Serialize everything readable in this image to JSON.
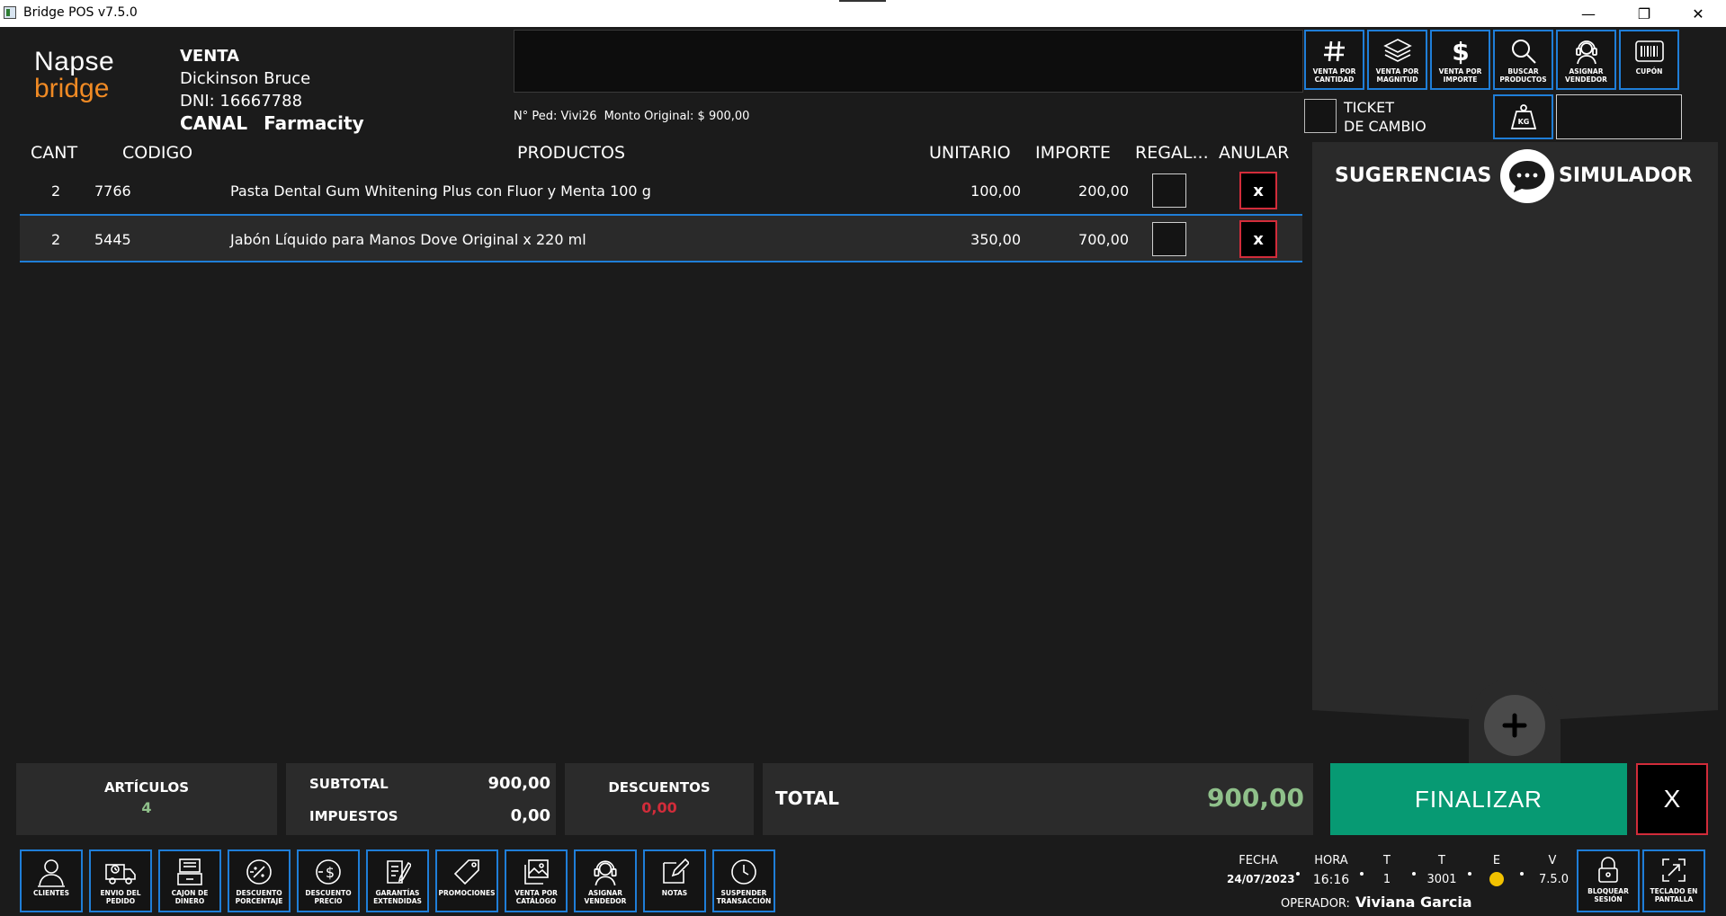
{
  "window": {
    "title": "Bridge POS v7.5.0",
    "controls": {
      "minimize": "—",
      "restore": "❐",
      "close": "✕"
    }
  },
  "logo": {
    "line1": "Napse",
    "line2": "bridge"
  },
  "customer": {
    "mode": "VENTA",
    "name": "Dickinson Bruce",
    "dni": "DNI: 16667788",
    "canal_label": "CANAL",
    "canal_value": "Farmacity"
  },
  "order": {
    "pedido": "N° Ped: Vivi26",
    "monto": "Monto Original: $ 900,00"
  },
  "top_actions": [
    {
      "icon": "hash-icon",
      "label": "VENTA POR CANTIDAD"
    },
    {
      "icon": "layers-icon",
      "label": "VENTA POR MAGNITUD"
    },
    {
      "icon": "dollar-icon",
      "label": "VENTA POR IMPORTE"
    },
    {
      "icon": "search-icon",
      "label": "BUSCAR PRODUCTOS"
    },
    {
      "icon": "headset-icon",
      "label": "ASIGNAR VENDEDOR"
    },
    {
      "icon": "barcode-icon",
      "label": "CUPÓN"
    }
  ],
  "ticket_cambio": {
    "line1": "TICKET",
    "line2": "DE CAMBIO"
  },
  "kg_label": "KG",
  "table": {
    "headers": {
      "cant": "CANT",
      "codigo": "CODIGO",
      "productos": "PRODUCTOS",
      "unitario": "UNITARIO",
      "importe": "IMPORTE",
      "regalo": "REGAL...",
      "anular": "ANULAR"
    },
    "rows": [
      {
        "cant": "2",
        "codigo": "7766",
        "producto": "Pasta Dental Gum Whitening Plus con Fluor y Menta 100 g",
        "unitario": "100,00",
        "importe": "200,00",
        "anular": "x"
      },
      {
        "cant": "2",
        "codigo": "5445",
        "producto": "Jabón Líquido para Manos Dove Original x 220 ml",
        "unitario": "350,00",
        "importe": "700,00",
        "anular": "x"
      }
    ]
  },
  "suggestions": {
    "left": "SUGERENCIAS",
    "right": "SIMULADOR"
  },
  "summary": {
    "articulos_label": "ARTÍCULOS",
    "articulos_value": "4",
    "subtotal_label": "SUBTOTAL",
    "subtotal_value": "900,00",
    "impuestos_label": "IMPUESTOS",
    "impuestos_value": "0,00",
    "descuentos_label": "DESCUENTOS",
    "descuentos_value": "0,00",
    "total_label": "TOTAL",
    "total_value": "900,00",
    "finalizar": "FINALIZAR",
    "cancel": "X"
  },
  "bottom_actions": [
    {
      "icon": "user-icon",
      "label": "CLIENTES"
    },
    {
      "icon": "delivery-truck-icon",
      "label": "ENVIO DEL PEDIDO"
    },
    {
      "icon": "cash-drawer-icon",
      "label": "CAJON DE DINERO"
    },
    {
      "icon": "percent-discount-icon",
      "label": "DESCUENTO PORCENTAJE"
    },
    {
      "icon": "dollar-discount-icon",
      "label": "DESCUENTO PRECIO"
    },
    {
      "icon": "warranty-icon",
      "label": "GARANTÍAS EXTENDIDAS"
    },
    {
      "icon": "tag-icon",
      "label": "PROMOCIONES"
    },
    {
      "icon": "catalog-icon",
      "label": "VENTA POR CATÁLOGO"
    },
    {
      "icon": "headset-icon",
      "label": "ASIGNAR VENDEDOR"
    },
    {
      "icon": "note-icon",
      "label": "NOTAS"
    },
    {
      "icon": "clock-icon",
      "label": "SUSPENDER TRANSACCIÓN"
    }
  ],
  "status": {
    "fecha_label": "FECHA",
    "fecha_value": "24/07/2023",
    "hora_label": "HORA",
    "hora_value": "16:16",
    "t1_label": "T",
    "t1_value": "1",
    "t2_label": "T",
    "t2_value": "3001",
    "e_label": "E",
    "v_label": "V",
    "v_value": "7.5.0",
    "e_color": "#f2c200"
  },
  "operator": {
    "label": "OPERADOR:",
    "name": "Viviana Garcia"
  },
  "right_actions": [
    {
      "icon": "lock-icon",
      "label": "BLOQUEAR SESIÓN"
    },
    {
      "icon": "expand-icon",
      "label": "TECLADO EN PANTALLA"
    }
  ],
  "colors": {
    "accent_blue": "#1f7ed8",
    "green": "#079a73",
    "red": "#d22c3a",
    "total_green": "#8fc08a",
    "brand_orange": "#f08a24"
  }
}
